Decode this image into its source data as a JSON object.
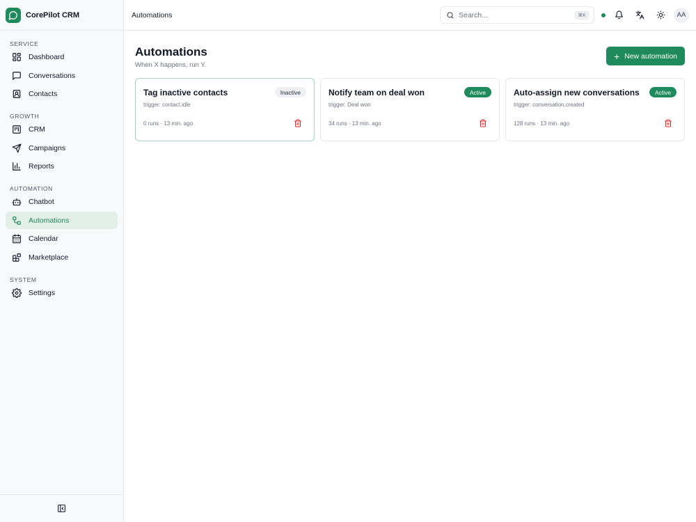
{
  "brand": {
    "name": "CorePilot CRM"
  },
  "sidebar": {
    "sections": [
      {
        "title": "SERVICE",
        "items": [
          {
            "label": "Dashboard",
            "icon": "dashboard-icon"
          },
          {
            "label": "Conversations",
            "icon": "chat-icon"
          },
          {
            "label": "Contacts",
            "icon": "contacts-icon"
          }
        ]
      },
      {
        "title": "GROWTH",
        "items": [
          {
            "label": "CRM",
            "icon": "kanban-icon"
          },
          {
            "label": "Campaigns",
            "icon": "send-icon"
          },
          {
            "label": "Reports",
            "icon": "bar-chart-icon"
          }
        ]
      },
      {
        "title": "AUTOMATION",
        "items": [
          {
            "label": "Chatbot",
            "icon": "bot-icon"
          },
          {
            "label": "Automations",
            "icon": "workflow-icon",
            "active": true
          },
          {
            "label": "Calendar",
            "icon": "calendar-icon"
          },
          {
            "label": "Marketplace",
            "icon": "blocks-icon"
          }
        ]
      },
      {
        "title": "SYSTEM",
        "items": [
          {
            "label": "Settings",
            "icon": "gear-icon"
          }
        ]
      }
    ]
  },
  "topbar": {
    "breadcrumb": "Automations",
    "search_placeholder": "Search...",
    "search_shortcut": "⌘K",
    "avatar_initials": "AA"
  },
  "page": {
    "title": "Automations",
    "subtitle": "When X happens, run Y.",
    "new_button": "New automation"
  },
  "automations": [
    {
      "title": "Tag inactive contacts",
      "status": "Inactive",
      "trigger": "trigger: contact.idle",
      "meta": "0 runs · 13 min. ago"
    },
    {
      "title": "Notify team on deal won",
      "status": "Active",
      "trigger": "trigger: Deal won",
      "meta": "34 runs · 13 min. ago"
    },
    {
      "title": "Auto-assign new conversations",
      "status": "Active",
      "trigger": "trigger: conversation.created",
      "meta": "128 runs · 13 min. ago"
    }
  ],
  "colors": {
    "accent": "#1f8a5b",
    "active_nav_bg": "#e3efe9",
    "danger": "#dc2626",
    "inactive_badge_bg": "#eef0f3"
  }
}
